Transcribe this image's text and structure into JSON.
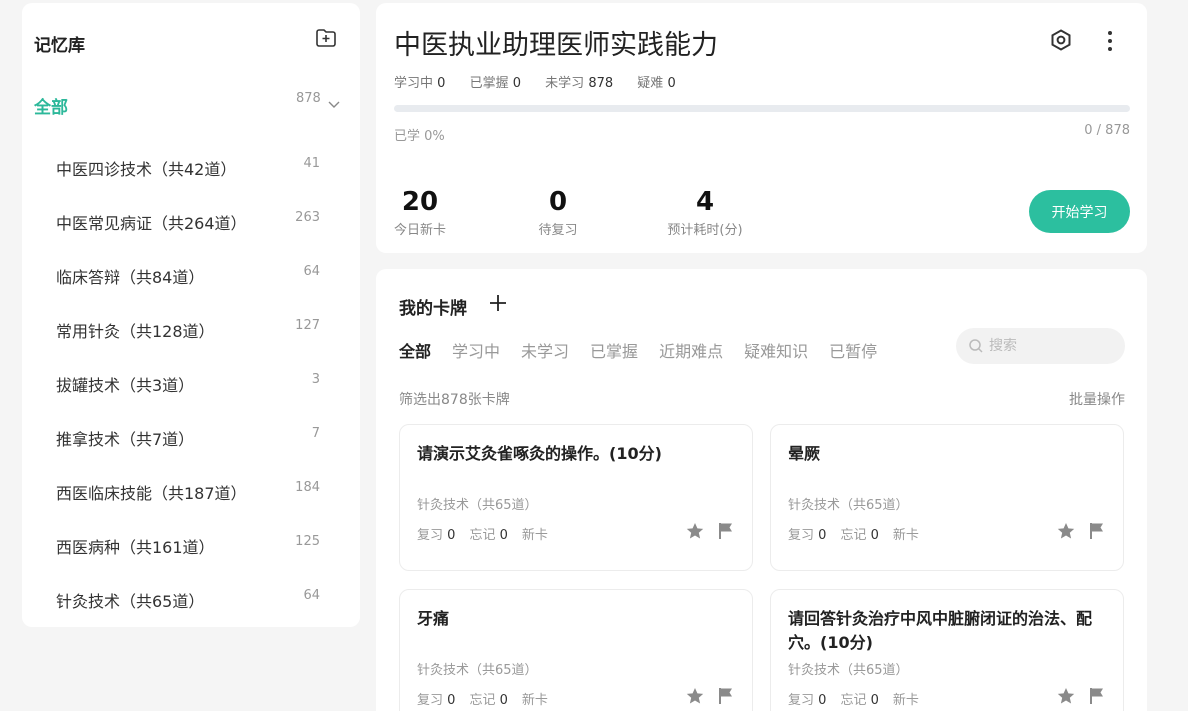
{
  "sidebar": {
    "title": "记忆库",
    "all": {
      "label": "全部",
      "count": "878"
    },
    "items": [
      {
        "label": "中医四诊技术（共42道）",
        "count": "41"
      },
      {
        "label": "中医常见病证（共264道）",
        "count": "263"
      },
      {
        "label": "临床答辩（共84道）",
        "count": "64"
      },
      {
        "label": "常用针灸（共128道）",
        "count": "127"
      },
      {
        "label": "拔罐技术（共3道）",
        "count": "3"
      },
      {
        "label": "推拿技术（共7道）",
        "count": "7"
      },
      {
        "label": "西医临床技能（共187道）",
        "count": "184"
      },
      {
        "label": "西医病种（共161道）",
        "count": "125"
      },
      {
        "label": "针灸技术（共65道）",
        "count": "64"
      }
    ]
  },
  "deck": {
    "title": "中医执业助理医师实践能力",
    "stats": {
      "learning_label": "学习中",
      "learning": "0",
      "mastered_label": "已掌握",
      "mastered": "0",
      "unlearned_label": "未学习",
      "unlearned": "878",
      "difficult_label": "疑难",
      "difficult": "0"
    },
    "progress_fraction": 0,
    "learned_text": "已学 0%",
    "ratio_text": "0 / 878",
    "today_new": "20",
    "today_new_label": "今日新卡",
    "to_review": "0",
    "to_review_label": "待复习",
    "est_time": "4",
    "est_time_label": "预计耗时(分)",
    "start_label": "开始学习"
  },
  "cards_panel": {
    "title": "我的卡牌",
    "tabs": [
      "全部",
      "学习中",
      "未学习",
      "已掌握",
      "近期难点",
      "疑难知识",
      "已暂停"
    ],
    "search_placeholder": "搜索",
    "filter_text": "筛选出878张卡牌",
    "batch_label": "批量操作",
    "cards": [
      {
        "question": "请演示艾灸雀啄灸的操作。(10分)",
        "tag": "针灸技术（共65道）",
        "review_label": "复习",
        "review": "0",
        "forget_label": "忘记",
        "forget": "0",
        "state": "新卡"
      },
      {
        "question": "晕厥",
        "tag": "针灸技术（共65道）",
        "review_label": "复习",
        "review": "0",
        "forget_label": "忘记",
        "forget": "0",
        "state": "新卡"
      },
      {
        "question": "牙痛",
        "tag": "针灸技术（共65道）",
        "review_label": "复习",
        "review": "0",
        "forget_label": "忘记",
        "forget": "0",
        "state": "新卡"
      },
      {
        "question": "请回答针灸治疗中风中脏腑闭证的治法、配穴。(10分)",
        "tag": "针灸技术（共65道）",
        "review_label": "复习",
        "review": "0",
        "forget_label": "忘记",
        "forget": "0",
        "state": "新卡"
      }
    ]
  },
  "colors": {
    "accent": "#2cb89a",
    "button": "#2cbf9f",
    "background": "#f5f5f5"
  }
}
